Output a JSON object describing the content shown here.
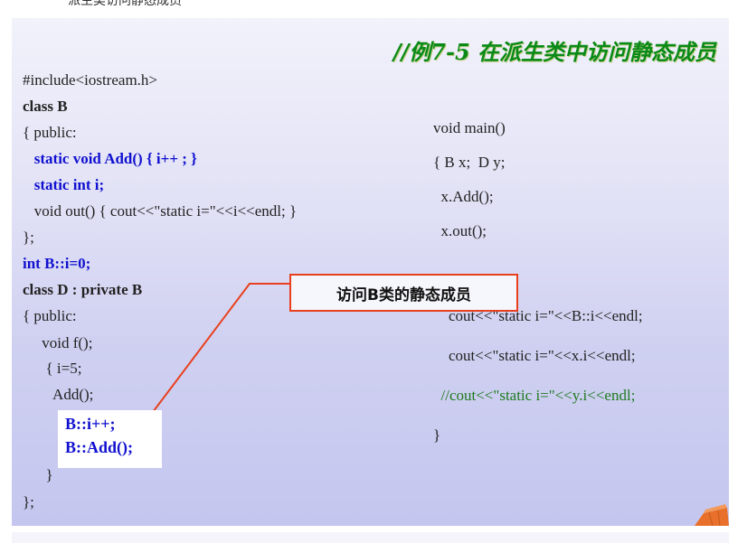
{
  "page": {
    "top_caption": "派生类访问静态成员"
  },
  "slide": {
    "title": "//例7-5  在派生类中访问静态成员",
    "left_code": [
      {
        "text": "#include<iostream.h>",
        "style": "normal"
      },
      {
        "text": "class B",
        "style": "bold"
      },
      {
        "text": "{ public:",
        "style": "normal"
      },
      {
        "text": "   static void Add() { i++ ; }",
        "style": "bold-blue"
      },
      {
        "text": "   static int i;",
        "style": "bold-blue"
      },
      {
        "text": "   void out() { cout<<\"static i=\"<<i<<endl; }",
        "style": "normal"
      },
      {
        "text": "};",
        "style": "normal"
      },
      {
        "text": "int B::i=0;",
        "style": "bold-blue"
      },
      {
        "text": "class D : private B",
        "style": "bold"
      },
      {
        "text": "{ public:",
        "style": "normal"
      },
      {
        "text": "     void f();",
        "style": "normal"
      },
      {
        "text": "      { i=5;",
        "style": "normal"
      },
      {
        "text": "        Add();",
        "style": "normal"
      },
      {
        "text": "      }",
        "style": "normal"
      },
      {
        "text": "};",
        "style": "normal"
      }
    ],
    "right_code": [
      {
        "text": "void main()",
        "style": "normal"
      },
      {
        "text": "{ B x;  D y;",
        "style": "normal"
      },
      {
        "text": "  x.Add();",
        "style": "normal"
      },
      {
        "text": "  x.out();",
        "style": "normal"
      },
      {
        "text": "    cout<<\"static i=\"<<B::i<<endl;",
        "style": "normal"
      },
      {
        "text": "    cout<<\"static i=\"<<x.i<<endl;",
        "style": "normal"
      },
      {
        "text": "  //cout<<\"static i=\"<<y.i<<endl;",
        "style": "green"
      },
      {
        "text": "}",
        "style": "normal"
      }
    ],
    "callout": {
      "text": "访问B类的静态成员",
      "border_color": "#e8401e"
    },
    "insert_box": {
      "lines": [
        "B::i++;",
        "B::Add();"
      ]
    },
    "colors": {
      "title": "#0a8a18",
      "keyword_blue": "#1010d0",
      "comment_green": "#1e7a1e"
    }
  }
}
